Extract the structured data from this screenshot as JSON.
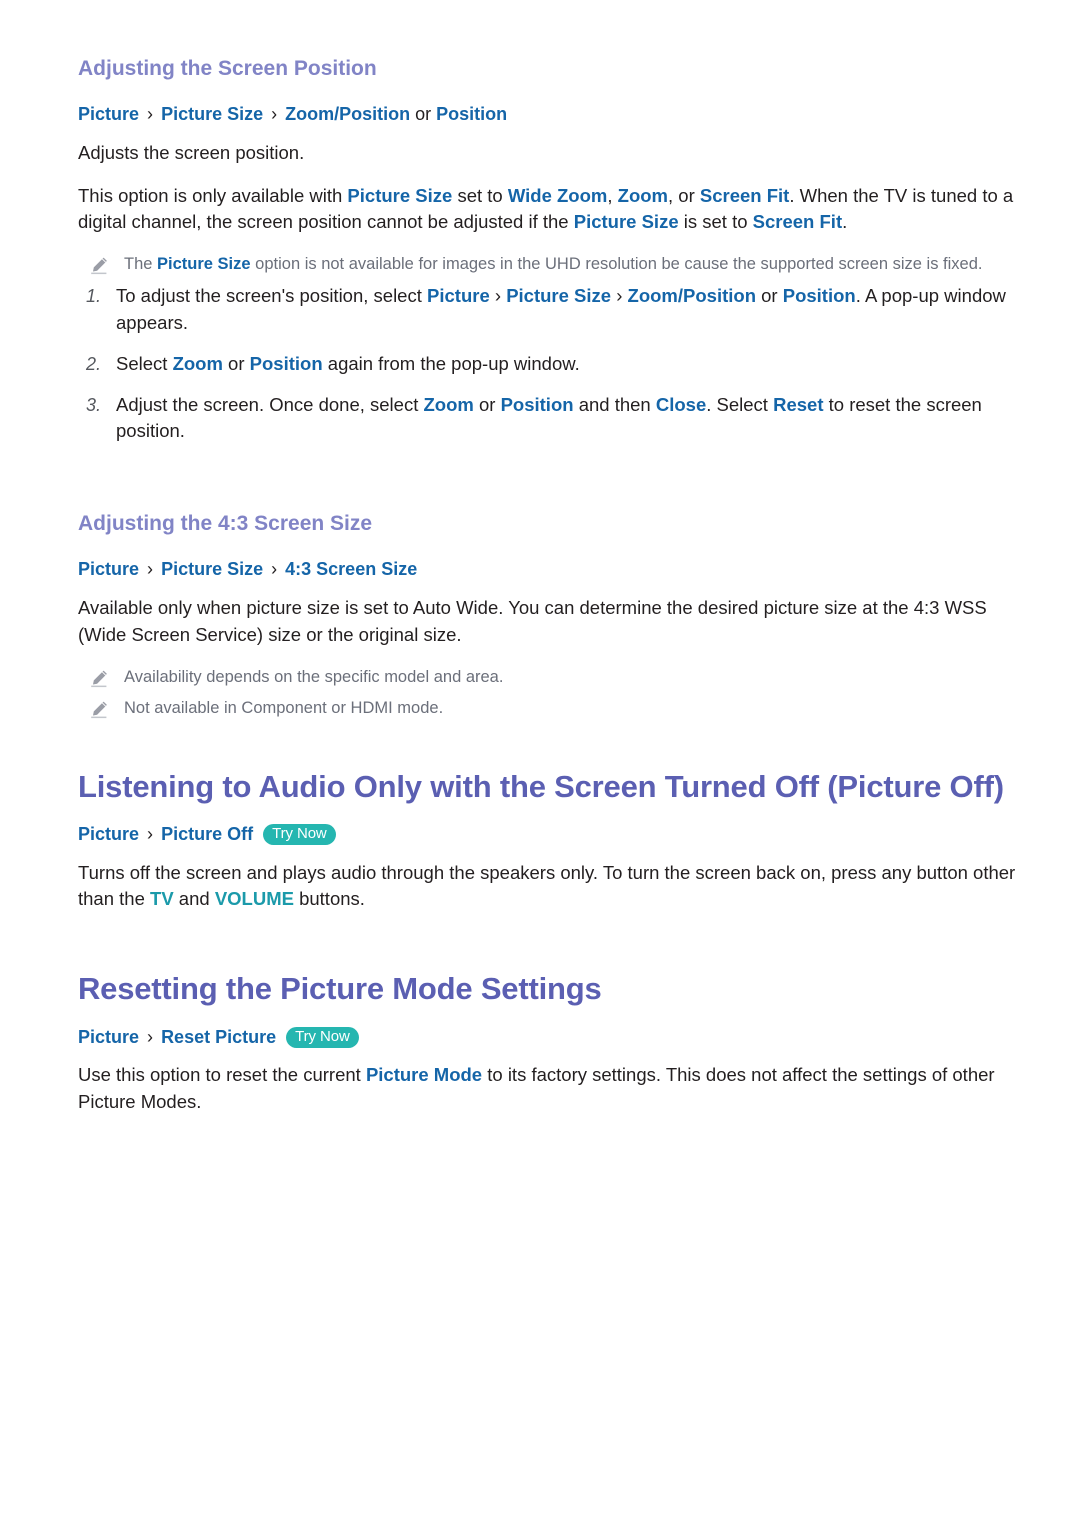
{
  "document": {
    "type": "e-manual-page",
    "colors": {
      "h1": "#5b5fb2",
      "h2": "#8184c6",
      "link": "#1565a8",
      "note_text": "#6b6f7a",
      "teal_accent": "#1b9aaa",
      "try_now_badge": "#25b6b0",
      "body_text": "#231f20",
      "background": "#ffffff"
    }
  },
  "sections": [
    {
      "id": "adjusting-screen-position",
      "heading_level": "h2",
      "heading": "Adjusting the Screen Position",
      "breadcrumb": {
        "parts": [
          "Picture",
          "Picture Size",
          "Zoom/Position"
        ],
        "separator": "›",
        "tail_plain": " or ",
        "tail_link": "Position"
      },
      "paragraphs": [
        {
          "id": "p-adjusts",
          "runs": [
            {
              "text": "Adjusts the screen position.",
              "style": "plain"
            }
          ]
        },
        {
          "id": "p-availability",
          "runs": [
            {
              "text": "This option is only available with ",
              "style": "plain"
            },
            {
              "text": "Picture Size",
              "style": "link"
            },
            {
              "text": " set to ",
              "style": "plain"
            },
            {
              "text": "Wide Zoom",
              "style": "link"
            },
            {
              "text": ", ",
              "style": "plain"
            },
            {
              "text": "Zoom",
              "style": "link"
            },
            {
              "text": ", or ",
              "style": "plain"
            },
            {
              "text": "Screen Fit",
              "style": "link"
            },
            {
              "text": ". When the TV is tuned to a digital channel, the screen position cannot be adjusted if the ",
              "style": "plain"
            },
            {
              "text": "Picture Size",
              "style": "link"
            },
            {
              "text": " is set to ",
              "style": "plain"
            },
            {
              "text": "Screen Fit",
              "style": "link"
            },
            {
              "text": ".",
              "style": "plain"
            }
          ]
        }
      ],
      "notes": [
        {
          "id": "note-uhd",
          "icon": "pencil-note-icon",
          "runs": [
            {
              "text": "The ",
              "style": "plain"
            },
            {
              "text": "Picture Size",
              "style": "link"
            },
            {
              "text": " option is not available for images in the UHD resolution be cause the supported screen size is fixed.",
              "style": "plain"
            }
          ]
        }
      ],
      "steps": [
        {
          "number": "1.",
          "runs": [
            {
              "text": "To adjust the screen's position, select ",
              "style": "plain"
            },
            {
              "text": "Picture",
              "style": "link"
            },
            {
              "text": " › ",
              "style": "sep"
            },
            {
              "text": "Picture Size",
              "style": "link"
            },
            {
              "text": " › ",
              "style": "sep"
            },
            {
              "text": "Zoom/Position",
              "style": "link"
            },
            {
              "text": " or ",
              "style": "plain"
            },
            {
              "text": "Position",
              "style": "link"
            },
            {
              "text": ". A pop-up window appears.",
              "style": "plain"
            }
          ]
        },
        {
          "number": "2.",
          "runs": [
            {
              "text": "Select ",
              "style": "plain"
            },
            {
              "text": "Zoom",
              "style": "link"
            },
            {
              "text": " or ",
              "style": "plain"
            },
            {
              "text": "Position",
              "style": "link"
            },
            {
              "text": " again from the pop-up window.",
              "style": "plain"
            }
          ]
        },
        {
          "number": "3.",
          "runs": [
            {
              "text": "Adjust the screen. Once done, select ",
              "style": "plain"
            },
            {
              "text": "Zoom",
              "style": "link"
            },
            {
              "text": " or ",
              "style": "plain"
            },
            {
              "text": "Position",
              "style": "link"
            },
            {
              "text": " and then ",
              "style": "plain"
            },
            {
              "text": "Close",
              "style": "link"
            },
            {
              "text": ". Select ",
              "style": "plain"
            },
            {
              "text": "Reset",
              "style": "link"
            },
            {
              "text": " to reset the screen position.",
              "style": "plain"
            }
          ]
        }
      ]
    },
    {
      "id": "adjusting-43-screen-size",
      "heading_level": "h2",
      "heading": "Adjusting the 4:3 Screen Size",
      "breadcrumb": {
        "parts": [
          "Picture",
          "Picture Size",
          "4:3 Screen Size"
        ],
        "separator": "›"
      },
      "paragraphs": [
        {
          "id": "p-autowide",
          "runs": [
            {
              "text": "Available only when picture size is set to Auto Wide. You can determine the desired picture size at the 4:3 WSS (Wide Screen Service) size or the original size.",
              "style": "plain"
            }
          ]
        }
      ],
      "notes": [
        {
          "id": "note-availability",
          "icon": "pencil-note-icon",
          "runs": [
            {
              "text": "Availability depends on the specific model and area.",
              "style": "plain"
            }
          ]
        },
        {
          "id": "note-component-hdmi",
          "icon": "pencil-note-icon",
          "runs": [
            {
              "text": "Not available in Component or HDMI mode.",
              "style": "plain"
            }
          ]
        }
      ]
    },
    {
      "id": "listening-audio-only",
      "heading_level": "h1",
      "heading": "Listening to Audio Only with the Screen Turned Off (Picture Off)",
      "breadcrumb": {
        "parts": [
          "Picture",
          "Picture Off"
        ],
        "separator": "›",
        "badge": "Try Now"
      },
      "paragraphs": [
        {
          "id": "p-picture-off",
          "runs": [
            {
              "text": "Turns off the screen and plays audio through the speakers only. To turn the screen back on, press any button other than the ",
              "style": "plain"
            },
            {
              "text": "TV",
              "style": "teal"
            },
            {
              "text": " and ",
              "style": "plain"
            },
            {
              "text": "VOLUME",
              "style": "teal"
            },
            {
              "text": " buttons.",
              "style": "plain"
            }
          ]
        }
      ]
    },
    {
      "id": "resetting-picture-mode",
      "heading_level": "h1",
      "heading": "Resetting the Picture Mode Settings",
      "breadcrumb": {
        "parts": [
          "Picture",
          "Reset Picture"
        ],
        "separator": "›",
        "badge": "Try Now"
      },
      "paragraphs": [
        {
          "id": "p-reset",
          "runs": [
            {
              "text": "Use this option to reset the current ",
              "style": "plain"
            },
            {
              "text": "Picture Mode",
              "style": "link"
            },
            {
              "text": " to its factory settings. This does not affect the settings of other Picture Modes.",
              "style": "plain"
            }
          ]
        }
      ]
    }
  ]
}
